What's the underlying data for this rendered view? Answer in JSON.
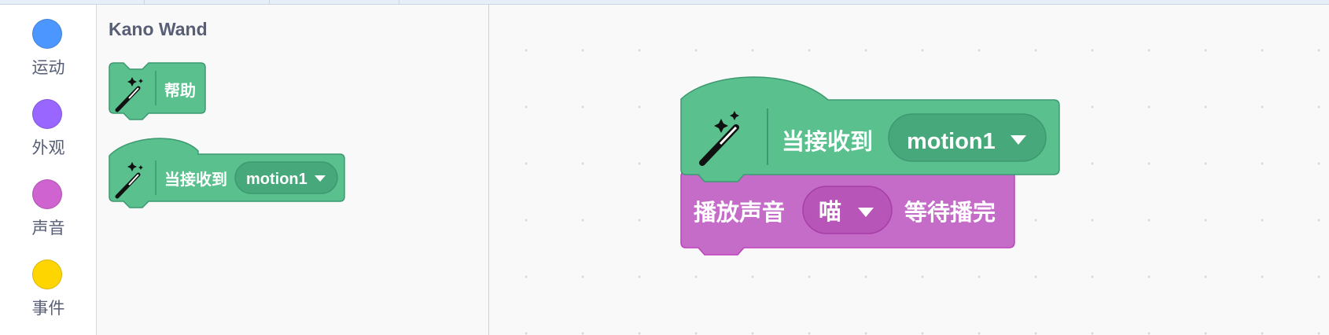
{
  "categories": [
    {
      "label": "运动",
      "color": "#4c97ff"
    },
    {
      "label": "外观",
      "color": "#9966ff"
    },
    {
      "label": "声音",
      "color": "#cf63cf"
    },
    {
      "label": "事件",
      "color": "#ffd500"
    }
  ],
  "flyout": {
    "title": "Kano Wand",
    "help_block": {
      "label": "帮助"
    },
    "event_block": {
      "label": "当接收到",
      "dropdown_value": "motion1"
    }
  },
  "workspace": {
    "event_block": {
      "label": "当接收到",
      "dropdown_value": "motion1"
    },
    "sound_block": {
      "label": "播放声音",
      "dropdown_value": "喵",
      "suffix": "等待播完"
    }
  },
  "colors": {
    "extension_green": "#59c08e",
    "extension_green_dark": "#3d9970",
    "sound_purple": "#cf63cf",
    "sound_purple_dark": "#bd42bd"
  }
}
